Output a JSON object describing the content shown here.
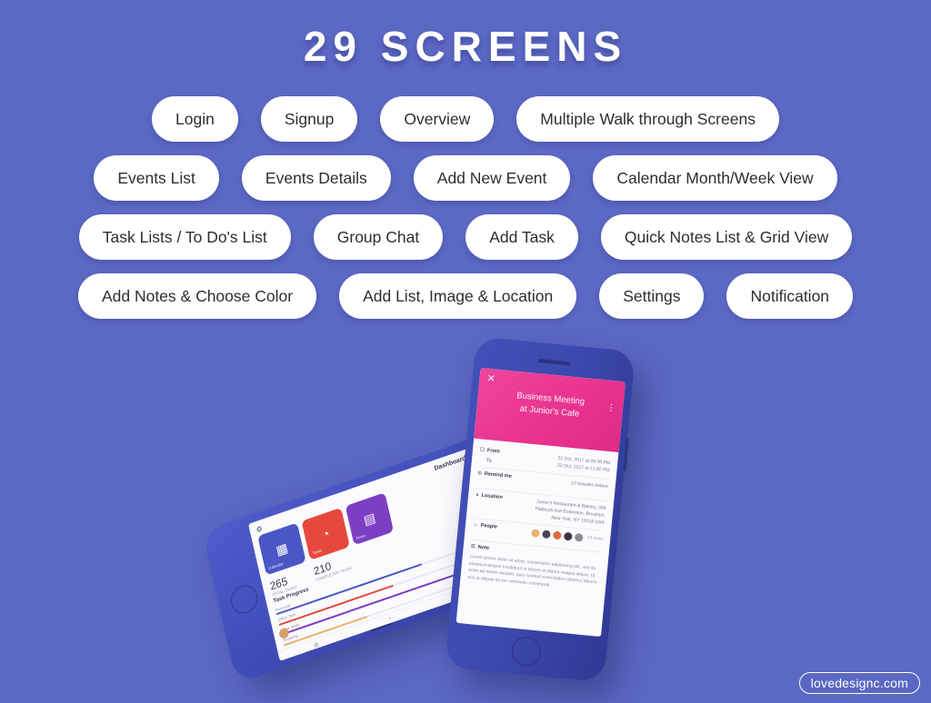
{
  "page": {
    "title": "29 SCREENS",
    "background_color": "#5b68c4",
    "watermark": "lovedesignc.com"
  },
  "pill_rows": [
    [
      "Login",
      "Signup",
      "Overview",
      "Multiple Walk through Screens"
    ],
    [
      "Events List",
      "Events Details",
      "Add New Event",
      "Calendar Month/Week View"
    ],
    [
      "Task Lists / To Do's List",
      "Group Chat",
      "Add Task",
      "Quick Notes List & Grid View"
    ],
    [
      "Add Notes & Choose Color",
      "Add List, Image & Location",
      "Settings",
      "Notification"
    ]
  ],
  "event_screen": {
    "close_icon": "✕",
    "menu_icon": "⋮",
    "header_color": "#e8328f",
    "title_line1": "Business Meeting",
    "title_line2": "at Junior's Cafe",
    "rows": {
      "from_label": "From",
      "from_icon": "Ὕ3",
      "to_label": "To",
      "from_value": "22 Oct, 2017 at 09:00 PM",
      "to_value": "22 Oct, 2017 at 11:00 PM",
      "remind_label": "Remind me",
      "remind_icon": "⏰",
      "remind_value": "10 minutes before",
      "location_label": "Location",
      "location_icon": "⌖",
      "location_value": "Junior's Restaurant & Bakery, 386 Flatbush Ave Extension, Brooklyn, New York, NY 10016 USA",
      "people_label": "People",
      "people_icon": "☺",
      "people_more": "+3 more",
      "note_label": "Note",
      "note_icon": "☰",
      "note_text": "Lorem ipsum dolor sit amet, consectetur adipisicing elit, sed do eiusmod tempor incididunt ut labore et dolore magna aliqua. Ut enim ad minim veniam, quis nostrud exercitation ullamco laboris nisi ut aliquip ex ea commodo consequat."
    }
  },
  "dashboard_screen": {
    "gear_icon": "⚙",
    "title": "Dashboard",
    "tiles": [
      {
        "label": "Calendar",
        "color": "#4a57c4",
        "icon": "▦"
      },
      {
        "label": "Tasks",
        "color": "#e7483e",
        "icon": "◔"
      },
      {
        "label": "Notes",
        "color": "#7b3fc4",
        "icon": "▤"
      }
    ],
    "stats": [
      {
        "value": "265",
        "label": "TOTAL TASKS"
      },
      {
        "value": "210",
        "label": "COMPLETED TASKS"
      }
    ],
    "progress_title": "Task Progress",
    "progress": [
      {
        "label": "Personal",
        "percent": "70%",
        "color": "#4a57c4",
        "width": "70%"
      },
      {
        "label": "Office Task",
        "percent": "55%",
        "color": "#e7483e",
        "width": "55%"
      },
      {
        "label": "Home Work",
        "percent": "85%",
        "color": "#7b3fc4",
        "width": "85%"
      },
      {
        "label": "Shopping",
        "percent": "40%",
        "color": "#e8b36a",
        "width": "40%"
      }
    ],
    "nav": [
      {
        "icon": "▦",
        "active": false
      },
      {
        "icon": "◔",
        "active": true
      },
      {
        "icon": "▤",
        "active": false
      }
    ]
  }
}
